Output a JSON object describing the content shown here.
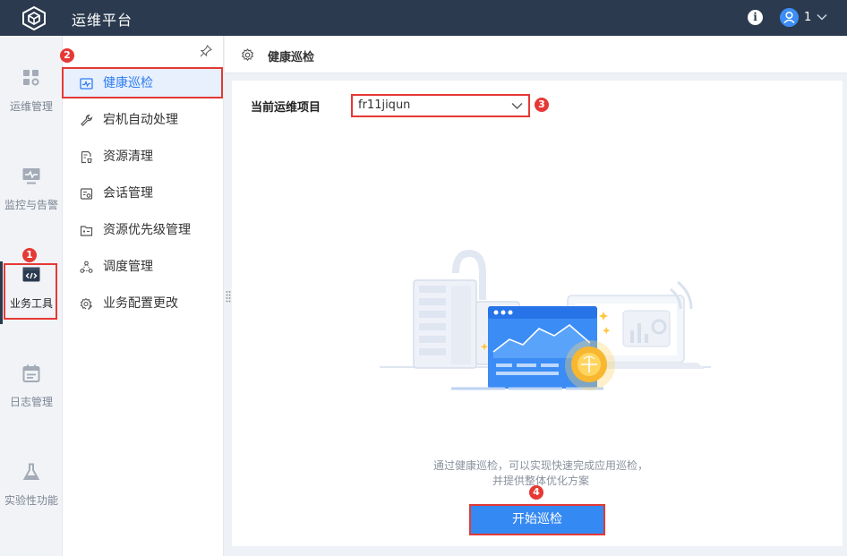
{
  "app": {
    "title": "运维平台"
  },
  "header": {
    "user_name": "1"
  },
  "rail": {
    "items": [
      {
        "label": "运维管理",
        "icon": "grid-settings-icon"
      },
      {
        "label": "监控与告警",
        "icon": "monitor-icon"
      },
      {
        "label": "业务工具",
        "icon": "code-window-icon",
        "active": true
      },
      {
        "label": "日志管理",
        "icon": "calendar-log-icon"
      },
      {
        "label": "实验性功能",
        "icon": "flask-icon"
      }
    ]
  },
  "submenu": {
    "items": [
      {
        "label": "健康巡检",
        "icon": "pulse-chart-icon",
        "active": true
      },
      {
        "label": "宕机自动处理",
        "icon": "wrench-icon"
      },
      {
        "label": "资源清理",
        "icon": "document-clean-icon"
      },
      {
        "label": "会话管理",
        "icon": "session-icon"
      },
      {
        "label": "资源优先级管理",
        "icon": "folder-priority-icon"
      },
      {
        "label": "调度管理",
        "icon": "nodes-icon"
      },
      {
        "label": "业务配置更改",
        "icon": "gear-edit-icon"
      }
    ]
  },
  "page": {
    "title": "健康巡检",
    "project_label": "当前运维项目",
    "project_value": "fr11jiqun",
    "description": "通过健康巡检，可以实现快速完成应用巡检，并提供整体优化方案",
    "start_button": "开始巡检"
  },
  "annotations": [
    "1",
    "2",
    "3",
    "4"
  ],
  "colors": {
    "topbar": "#2b3a4e",
    "accent": "#2d7cf2",
    "annotation": "#e53935",
    "button": "#3589f3"
  }
}
